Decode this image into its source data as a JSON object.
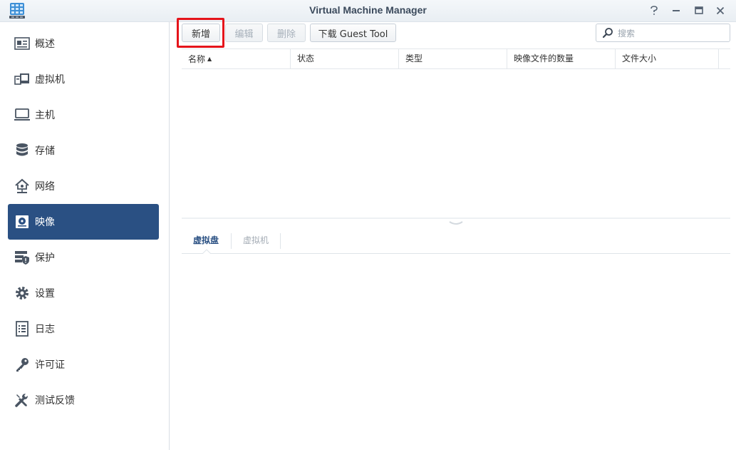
{
  "window": {
    "title": "Virtual Machine Manager",
    "controls": [
      "help-icon",
      "minimize-icon",
      "maximize-icon",
      "close-icon"
    ]
  },
  "sidebar": {
    "items": [
      {
        "label": "概述",
        "icon": "overview-icon"
      },
      {
        "label": "虚拟机",
        "icon": "virtual-machine-icon"
      },
      {
        "label": "主机",
        "icon": "host-icon"
      },
      {
        "label": "存储",
        "icon": "storage-icon"
      },
      {
        "label": "网络",
        "icon": "network-icon"
      },
      {
        "label": "映像",
        "icon": "image-icon",
        "active": true
      },
      {
        "label": "保护",
        "icon": "protection-icon"
      },
      {
        "label": "设置",
        "icon": "settings-icon"
      },
      {
        "label": "日志",
        "icon": "log-icon"
      },
      {
        "label": "许可证",
        "icon": "license-key-icon"
      },
      {
        "label": "测试反馈",
        "icon": "feedback-tools-icon"
      }
    ]
  },
  "toolbar": {
    "add_label": "新增",
    "edit_label": "编辑",
    "delete_label": "删除",
    "download_label": "下载 Guest Tool",
    "search_placeholder": "搜索"
  },
  "table": {
    "columns": [
      "名称",
      "状态",
      "类型",
      "映像文件的数量",
      "文件大小"
    ],
    "rows": []
  },
  "detail_tabs": [
    {
      "label": "虚拟盘",
      "active": true
    },
    {
      "label": "虚拟机",
      "active": false
    }
  ],
  "colors": {
    "accent": "#2a5083",
    "highlight": "#e5141b"
  }
}
